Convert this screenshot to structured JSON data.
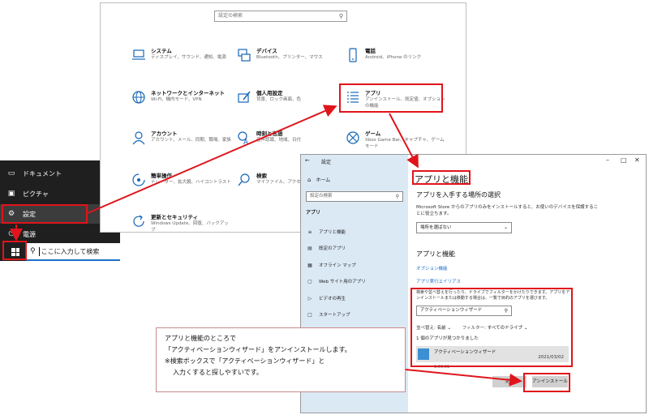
{
  "start_menu": {
    "items": [
      {
        "label": "ドキュメント",
        "icon": "document-icon"
      },
      {
        "label": "ピクチャ",
        "icon": "picture-icon"
      },
      {
        "label": "設定",
        "icon": "gear-icon"
      },
      {
        "label": "電源",
        "icon": "power-icon"
      }
    ],
    "search_text": "ここに入力して検索"
  },
  "settings_home": {
    "search_placeholder": "設定の検索",
    "categories": [
      {
        "title": "システム",
        "desc": "ディスプレイ、サウンド、通知、電源",
        "icon": "laptop-icon"
      },
      {
        "title": "デバイス",
        "desc": "Bluetooth、プリンター、マウス",
        "icon": "keyboard-icon"
      },
      {
        "title": "電話",
        "desc": "Android、iPhone のリンク",
        "icon": "phone-icon"
      },
      {
        "title": "ネットワークとインターネット",
        "desc": "Wi-Fi、機内モード、VPN",
        "icon": "globe-icon"
      },
      {
        "title": "個人用設定",
        "desc": "背景、ロック画面、色",
        "icon": "paint-icon"
      },
      {
        "title": "アプリ",
        "desc": "アンインストール、既定値、オプションの機能",
        "icon": "apps-list-icon"
      },
      {
        "title": "アカウント",
        "desc": "アカウント、メール、同期、職場、家族",
        "icon": "person-icon"
      },
      {
        "title": "時刻と言語",
        "desc": "音声認識、地域、日付",
        "icon": "time-language-icon"
      },
      {
        "title": "ゲーム",
        "desc": "Xbox Game Bar、キャプチャ、ゲーム モード",
        "icon": "xbox-icon"
      },
      {
        "title": "簡単操作",
        "desc": "ナレーター、拡大鏡、ハイコントラスト",
        "icon": "accessibility-icon"
      },
      {
        "title": "検索",
        "desc": "マイファイル、アクセス許可",
        "icon": "search-icon"
      },
      {
        "title": "更新とセキュリティ",
        "desc": "Windows Update、回復、バックアップ",
        "icon": "update-icon"
      }
    ]
  },
  "apps_window": {
    "title": "設定",
    "nav": {
      "home": "ホーム",
      "search_placeholder": "設定の検索",
      "section": "アプリ",
      "items": [
        {
          "label": "アプリと機能",
          "icon": "list-icon"
        },
        {
          "label": "既定のアプリ",
          "icon": "default-apps-icon"
        },
        {
          "label": "オフライン マップ",
          "icon": "map-icon"
        },
        {
          "label": "Web サイト用のアプリ",
          "icon": "web-app-icon"
        },
        {
          "label": "ビデオの再生",
          "icon": "video-icon"
        },
        {
          "label": "スタートアップ",
          "icon": "startup-icon"
        }
      ]
    },
    "page_title": "アプリと機能",
    "install_heading": "アプリを入手する場所の選択",
    "install_desc": "Microsoft Store からのアプリのみをインストールすると、お使いのデバイスを保護することに役立ちます。",
    "location_dropdown": "場所を選ばない",
    "features_heading": "アプリと機能",
    "link_optional": "オプション機能",
    "link_alias": "アプリ実行エイリアス",
    "filter_desc": "検索や並べ替えを行ったり、ドライブでフィルターをかけたりできます。アプリをアンインストールまたは移動する場合は、一覧で目的のアプリを選びます。",
    "app_search_value": "アクティベーションウィザード",
    "sort_label": "並べ替え:",
    "sort_value": "名前",
    "filter_label": "フィルター:",
    "filter_value": "すべてのドライブ",
    "found_count": "1 個のアプリが見つかりました",
    "app": {
      "name": "アクティベーションウィザード",
      "date": "2021/03/02",
      "version": "1.00.01"
    },
    "move_label": "変更",
    "uninstall_label": "アンインストール"
  },
  "callout": {
    "line1": "アプリと機能のところで",
    "line2": "「アクティベーションウィザード」をアンインストールします。",
    "line3": "※検索ボックスで「アクティベーションウィザード」と",
    "line4": "入力くすると探しやすいです。"
  },
  "colors": {
    "highlight": "#e0141b",
    "accent": "#1a6fc9",
    "nav_bg": "#dbe9f5"
  }
}
